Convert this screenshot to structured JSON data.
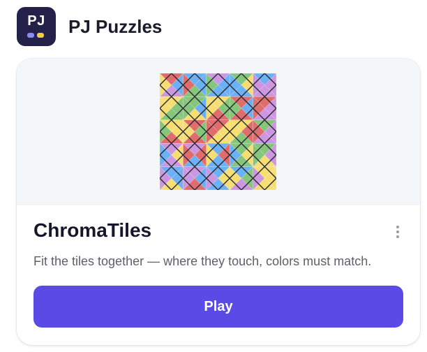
{
  "header": {
    "logo_text": "PJ",
    "title": "PJ Puzzles"
  },
  "card": {
    "title": "ChromaTiles",
    "description": "Fit the tiles together — where they touch, colors must match.",
    "play_label": "Play",
    "more_icon": "more-vertical-icon"
  },
  "puzzle": {
    "palette": {
      "R": "#e06c6c",
      "G": "#85c67a",
      "B": "#6cb1f5",
      "P": "#cc96e0",
      "Y": "#f6de72"
    },
    "tiles": [
      [
        "RBPY",
        "BBGR",
        "PBBG",
        "GYBB",
        "BPPP"
      ],
      [
        "YGGY",
        "GBYG",
        "YGRY",
        "RBRG",
        "RPPR"
      ],
      [
        "YYRG",
        "RGRY",
        "RYYR",
        "YRGY",
        "GPPR"
      ],
      [
        "PYPB",
        "PRBR",
        "BRBY",
        "GYGB",
        "GPYG"
      ],
      [
        "BBYP",
        "PBRP",
        "BYBP",
        "BGPY",
        "YYYP"
      ]
    ]
  },
  "colors": {
    "accent": "#5b4be6",
    "logo_bg": "#23204a"
  }
}
